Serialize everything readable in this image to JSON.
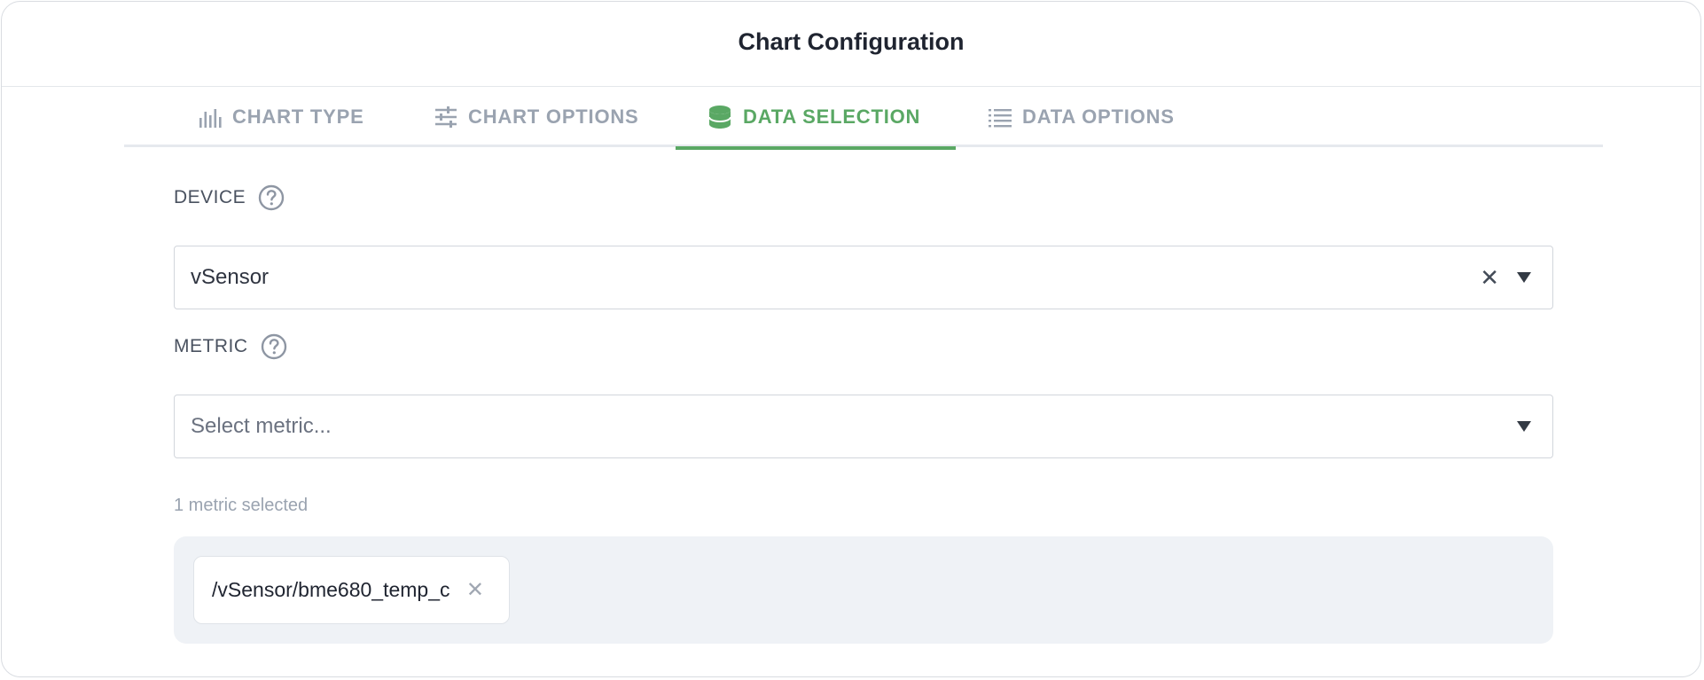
{
  "dialog": {
    "title": "Chart Configuration"
  },
  "tabs": [
    {
      "label": "CHART TYPE",
      "icon": "bar-chart-icon",
      "active": false
    },
    {
      "label": "CHART OPTIONS",
      "icon": "sliders-icon",
      "active": false
    },
    {
      "label": "DATA SELECTION",
      "icon": "database-icon",
      "active": true
    },
    {
      "label": "DATA OPTIONS",
      "icon": "list-icon",
      "active": false
    }
  ],
  "device": {
    "label": "DEVICE",
    "value": "vSensor",
    "clear_glyph": "✕"
  },
  "metric": {
    "label": "METRIC",
    "placeholder": "Select metric..."
  },
  "selection": {
    "count_text": "1 metric selected",
    "chips": [
      {
        "label": "/vSensor/bme680_temp_c",
        "remove_glyph": "✕"
      }
    ]
  },
  "colors": {
    "accent": "#5aa864",
    "tab_inactive": "#9aa3b0",
    "chip_area": "#eff2f6"
  }
}
